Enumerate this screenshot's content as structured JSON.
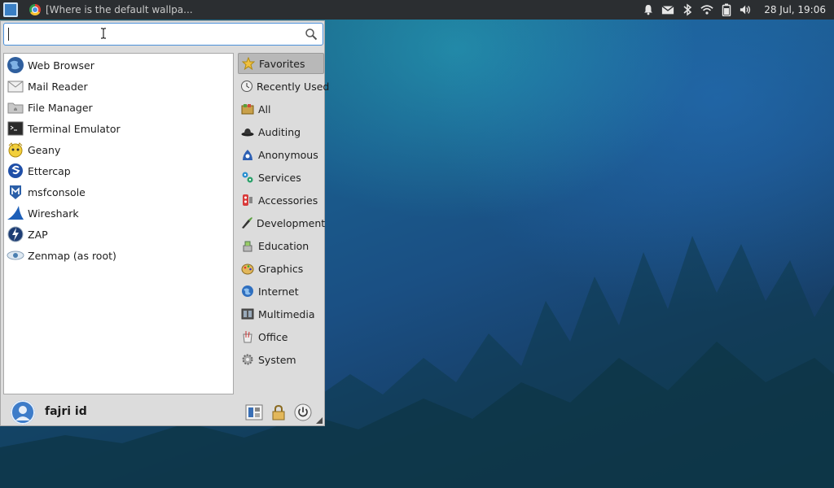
{
  "panel": {
    "task_title": "[Where is the default wallpa...",
    "clock": "28 Jul, 19:06"
  },
  "menu": {
    "search": {
      "value": "",
      "placeholder": ""
    },
    "apps": [
      {
        "label": "Web Browser",
        "icon": "web-browser-icon"
      },
      {
        "label": "Mail Reader",
        "icon": "mail-reader-icon"
      },
      {
        "label": "File Manager",
        "icon": "file-manager-icon"
      },
      {
        "label": "Terminal Emulator",
        "icon": "terminal-icon"
      },
      {
        "label": "Geany",
        "icon": "geany-icon"
      },
      {
        "label": "Ettercap",
        "icon": "ettercap-icon"
      },
      {
        "label": "msfconsole",
        "icon": "metasploit-icon"
      },
      {
        "label": "Wireshark",
        "icon": "wireshark-icon"
      },
      {
        "label": "ZAP",
        "icon": "zap-icon"
      },
      {
        "label": "Zenmap (as root)",
        "icon": "zenmap-icon"
      }
    ],
    "categories": [
      {
        "label": "Favorites",
        "icon": "star-icon",
        "selected": true
      },
      {
        "label": "Recently Used",
        "icon": "clock-icon"
      },
      {
        "label": "All",
        "icon": "all-apps-icon"
      },
      {
        "label": "Auditing",
        "icon": "hat-icon"
      },
      {
        "label": "Anonymous",
        "icon": "anonymous-icon"
      },
      {
        "label": "Services",
        "icon": "services-icon"
      },
      {
        "label": "Accessories",
        "icon": "accessories-icon"
      },
      {
        "label": "Development",
        "icon": "development-icon"
      },
      {
        "label": "Education",
        "icon": "education-icon"
      },
      {
        "label": "Graphics",
        "icon": "graphics-icon"
      },
      {
        "label": "Internet",
        "icon": "internet-icon"
      },
      {
        "label": "Multimedia",
        "icon": "multimedia-icon"
      },
      {
        "label": "Office",
        "icon": "office-icon"
      },
      {
        "label": "System",
        "icon": "system-icon"
      }
    ],
    "user": {
      "name": "fajri id"
    }
  },
  "colors": {
    "accent": "#4a90d9",
    "panel_bg": "#2b2e31",
    "menu_bg": "#dcdcdc",
    "selected_category": "#b8b8b8"
  }
}
